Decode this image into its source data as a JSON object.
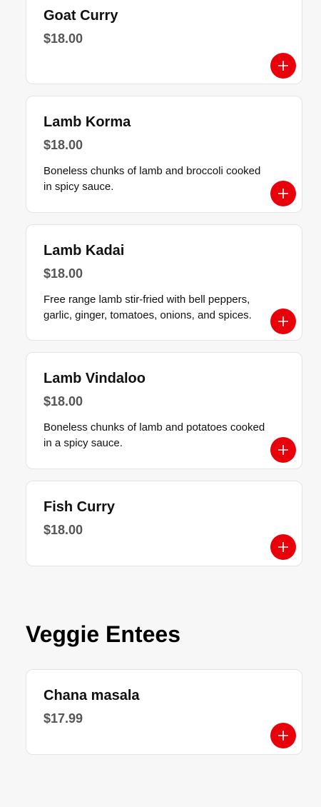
{
  "categories": [
    {
      "title": "",
      "items": [
        {
          "name": "Goat Curry",
          "price": "$18.00",
          "description": ""
        },
        {
          "name": "Lamb Korma",
          "price": "$18.00",
          "description": "Boneless chunks of lamb and broccoli cooked in spicy sauce."
        },
        {
          "name": "Lamb Kadai",
          "price": "$18.00",
          "description": "Free range lamb stir-fried with bell peppers, garlic, ginger, tomatoes, onions, and spices."
        },
        {
          "name": "Lamb Vindaloo",
          "price": "$18.00",
          "description": "Boneless chunks of lamb and potatoes cooked in a spicy sauce."
        },
        {
          "name": "Fish Curry",
          "price": "$18.00",
          "description": ""
        }
      ]
    },
    {
      "title": "Veggie Entees",
      "items": [
        {
          "name": "Chana masala",
          "price": "$17.99",
          "description": ""
        }
      ]
    }
  ],
  "icons": {
    "add": "plus-icon"
  },
  "colors": {
    "accent": "#e8000b",
    "price": "#555555",
    "background": "#f7f7f8"
  }
}
